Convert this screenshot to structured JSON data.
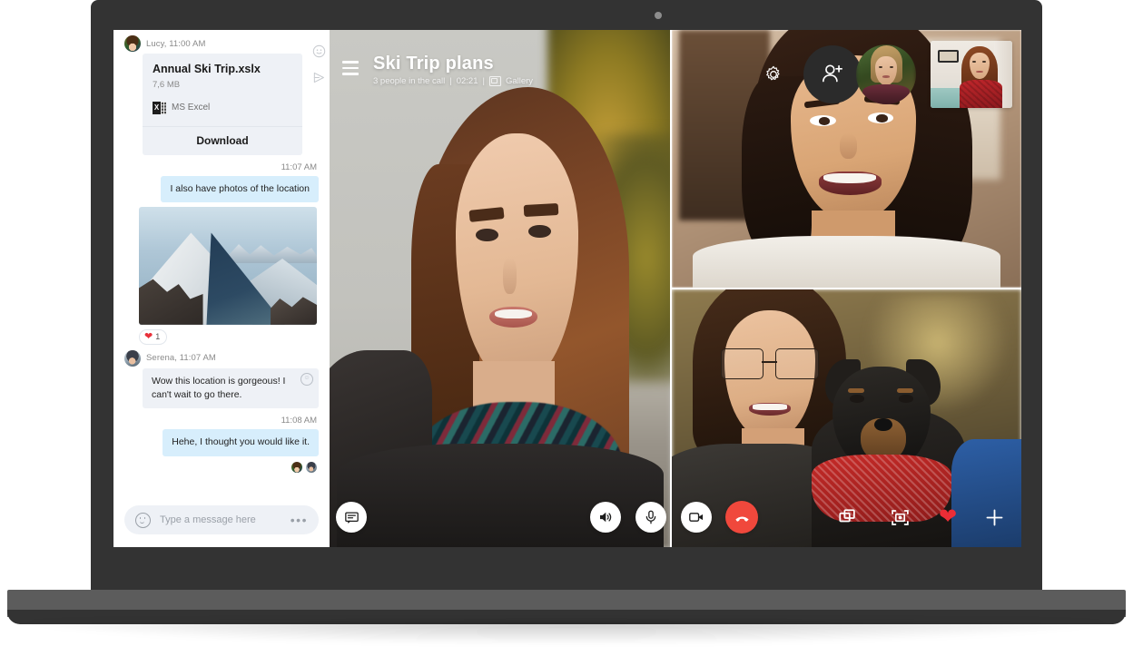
{
  "device": {
    "name": "laptop-mockup",
    "webcam": "webcam-dot"
  },
  "chat": {
    "messages": [
      {
        "type": "file",
        "sender": "Lucy",
        "header": "Lucy, 11:00 AM",
        "file_name": "Annual Ski Trip.xslx",
        "file_size": "7,6 MB",
        "app_label": "MS Excel",
        "app_icon": "excel-icon",
        "download_label": "Download"
      },
      {
        "type": "time",
        "time": "11:07 AM"
      },
      {
        "type": "out",
        "text": "I also have photos of the location"
      },
      {
        "type": "photo",
        "alt": "snowy-mountain-ridge-photo"
      },
      {
        "type": "reaction",
        "emoji": "heart-icon",
        "count": "1"
      },
      {
        "type": "in",
        "sender": "Serena",
        "header": "Serena, 11:07 AM",
        "text": "Wow this location is gorgeous! I can't wait to go there.",
        "emoji_button": "smiley-icon"
      },
      {
        "type": "time",
        "time": "11:08 AM"
      },
      {
        "type": "out",
        "text": "Hehe, I thought you would like it."
      }
    ],
    "side_icons": [
      "smiley-icon",
      "send-icon"
    ],
    "composer": {
      "emoji_icon": "smiley-icon",
      "placeholder": "Type a message here",
      "value": "",
      "more_label": "•••"
    }
  },
  "call": {
    "menu_icon": "hamburger-icon",
    "title": "Ski Trip plans",
    "status_people": "3 people in the call",
    "status_sep": "|",
    "status_timer": "02:21",
    "status_view_icon": "gallery-icon",
    "status_view": "Gallery",
    "top_right": {
      "settings_icon": "gear-icon",
      "add_person_icon": "add-person-icon",
      "self_circle": "participant-avatar-circle",
      "self_rect": "self-view-thumbnail"
    },
    "controls_left": [
      {
        "name": "chat-toggle-button",
        "icon": "chat-bubble-icon",
        "style": "white"
      }
    ],
    "controls_center": [
      {
        "name": "speaker-button",
        "icon": "speaker-icon",
        "style": "white"
      },
      {
        "name": "microphone-button",
        "icon": "microphone-icon",
        "style": "white"
      },
      {
        "name": "camera-button",
        "icon": "video-camera-icon",
        "style": "white"
      },
      {
        "name": "end-call-button",
        "icon": "hang-up-icon",
        "style": "red"
      }
    ],
    "controls_right": [
      {
        "name": "share-screen-button",
        "icon": "share-screen-icon"
      },
      {
        "name": "snapshot-button",
        "icon": "snapshot-icon"
      },
      {
        "name": "reaction-button",
        "icon": "heart-icon"
      },
      {
        "name": "add-button",
        "icon": "plus-icon"
      }
    ],
    "tiles": [
      {
        "name": "video-tile-main",
        "label": ""
      },
      {
        "name": "video-tile-top-right",
        "label": ""
      },
      {
        "name": "video-tile-bottom-right",
        "label": ""
      }
    ]
  },
  "colors": {
    "accent_blue": "#d7eefc",
    "bubble_grey": "#eef1f6",
    "end_call_red": "#f0483c",
    "heart_red": "#e8303a",
    "frame_dark": "#333333",
    "hinge_grey": "#5c5c5c"
  }
}
